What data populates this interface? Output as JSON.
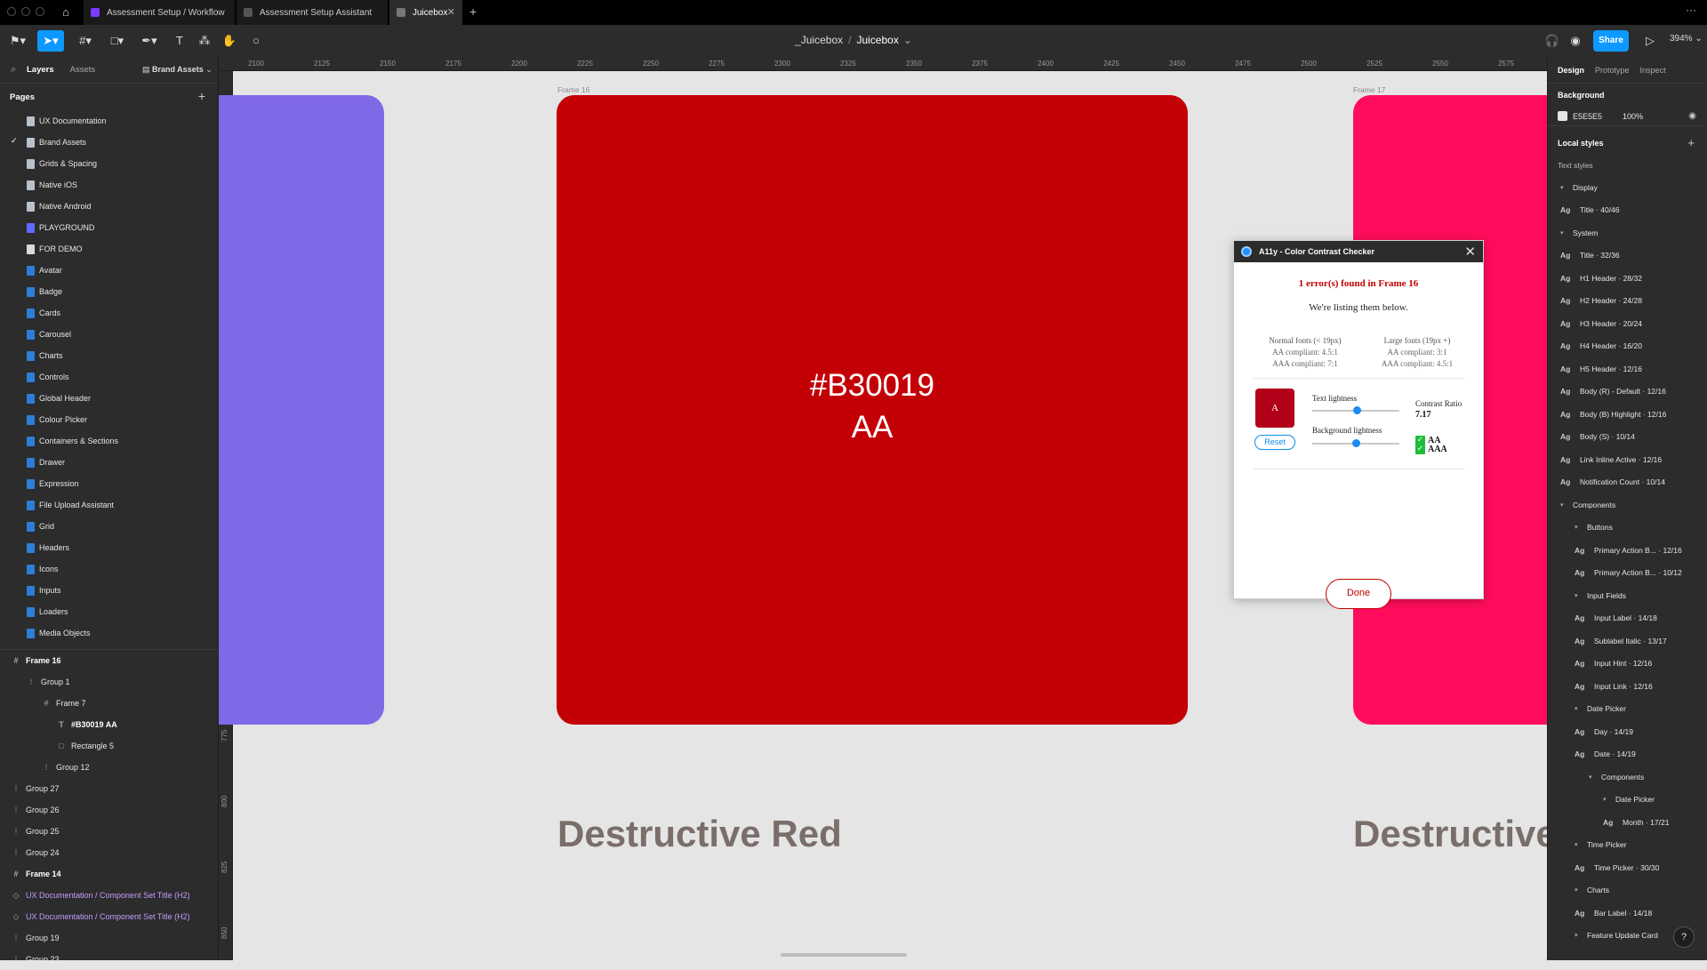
{
  "browser": {
    "tabs": [
      {
        "label": "Assessment Setup / Workflow",
        "color": "#7b3cff"
      },
      {
        "label": "Assessment Setup Assistant",
        "color": "#555555"
      },
      {
        "label": "Juicebox",
        "color": "#555555"
      }
    ],
    "new_tab": "+",
    "more": "···"
  },
  "toolbar": {
    "breadcrumb_team": "_Juicebox",
    "breadcrumb_sep": "/",
    "breadcrumb_file": "Juicebox",
    "share_label": "Share",
    "zoom": "394%"
  },
  "left": {
    "tabs": [
      "Layers",
      "Assets"
    ],
    "page_selector": "Brand Assets",
    "pages_title": "Pages",
    "pages": [
      {
        "label": "UX Documentation",
        "color": "#b8c1cc",
        "selected": false
      },
      {
        "label": "Brand Assets",
        "color": "#b8c1cc",
        "selected": true
      },
      {
        "label": "Grids & Spacing",
        "color": "#b8c1cc",
        "selected": false
      },
      {
        "label": "Native iOS",
        "color": "#b8c1cc",
        "selected": false
      },
      {
        "label": "Native Android",
        "color": "#b8c1cc",
        "selected": false
      },
      {
        "label": "PLAYGROUND",
        "color": "#5b6cff",
        "selected": false
      },
      {
        "label": "FOR DEMO",
        "color": "#d9d9d9",
        "selected": false
      },
      {
        "label": "Avatar",
        "color": "#2b7fd8",
        "selected": false
      },
      {
        "label": "Badge",
        "color": "#2b7fd8",
        "selected": false
      },
      {
        "label": "Cards",
        "color": "#2b7fd8",
        "selected": false
      },
      {
        "label": "Carousel",
        "color": "#2b7fd8",
        "selected": false
      },
      {
        "label": "Charts",
        "color": "#2b7fd8",
        "selected": false
      },
      {
        "label": "Controls",
        "color": "#2b7fd8",
        "selected": false
      },
      {
        "label": "Global Header",
        "color": "#2b7fd8",
        "selected": false
      },
      {
        "label": "Colour Picker",
        "color": "#2b7fd8",
        "selected": false
      },
      {
        "label": "Containers & Sections",
        "color": "#2b7fd8",
        "selected": false
      },
      {
        "label": "Drawer",
        "color": "#2b7fd8",
        "selected": false
      },
      {
        "label": "Expression",
        "color": "#2b7fd8",
        "selected": false
      },
      {
        "label": "File Upload Assistant",
        "color": "#2b7fd8",
        "selected": false
      },
      {
        "label": "Grid",
        "color": "#2b7fd8",
        "selected": false
      },
      {
        "label": "Headers",
        "color": "#2b7fd8",
        "selected": false
      },
      {
        "label": "Icons",
        "color": "#2b7fd8",
        "selected": false
      },
      {
        "label": "Inputs",
        "color": "#2b7fd8",
        "selected": false
      },
      {
        "label": "Loaders",
        "color": "#2b7fd8",
        "selected": false
      },
      {
        "label": "Media Objects",
        "color": "#2b7fd8",
        "selected": false
      }
    ],
    "layers": [
      {
        "label": "Frame 16",
        "icon": "#",
        "depth": 0,
        "style": "bold"
      },
      {
        "label": "Group 1",
        "icon": "⁞",
        "depth": 1,
        "style": ""
      },
      {
        "label": "Frame 7",
        "icon": "#",
        "depth": 2,
        "style": ""
      },
      {
        "label": "#B30019 AA",
        "icon": "T",
        "depth": 3,
        "style": "bold"
      },
      {
        "label": "Rectangle 5",
        "icon": "□",
        "depth": 3,
        "style": ""
      },
      {
        "label": "Group 12",
        "icon": "⁞",
        "depth": 2,
        "style": ""
      },
      {
        "label": "Group 27",
        "icon": "⁞",
        "depth": 0,
        "style": ""
      },
      {
        "label": "Group 26",
        "icon": "⁞",
        "depth": 0,
        "style": ""
      },
      {
        "label": "Group 25",
        "icon": "⁞",
        "depth": 0,
        "style": ""
      },
      {
        "label": "Group 24",
        "icon": "⁞",
        "depth": 0,
        "style": ""
      },
      {
        "label": "Frame 14",
        "icon": "#",
        "depth": 0,
        "style": "bold"
      },
      {
        "label": "UX Documentation / Component Set Title (H2)",
        "icon": "◇",
        "depth": 0,
        "style": "purple"
      },
      {
        "label": "UX Documentation / Component Set Title (H2)",
        "icon": "◇",
        "depth": 0,
        "style": "purple"
      },
      {
        "label": "Group 19",
        "icon": "⁞",
        "depth": 0,
        "style": ""
      },
      {
        "label": "Group 23",
        "icon": "⁞",
        "depth": 0,
        "style": ""
      }
    ]
  },
  "canvas": {
    "ruler_top": [
      "2100",
      "2125",
      "2150",
      "2175",
      "2200",
      "2225",
      "2250",
      "2275",
      "2300",
      "2325",
      "2350",
      "2375",
      "2400",
      "2425",
      "2450",
      "2475",
      "2500",
      "2525",
      "2550",
      "2575"
    ],
    "ruler_left": [
      "550",
      "575",
      "600",
      "625",
      "650",
      "675",
      "700",
      "725",
      "750",
      "775",
      "800",
      "825",
      "850"
    ],
    "frame16_label": "Frame 16",
    "frame17_label": "Frame 17",
    "swatch_left_color": "#8069E6",
    "swatch_main_color": "#C40007",
    "swatch_right_color": "#FF0D5C",
    "swatch_hex": "#B30019",
    "swatch_rating": "AA",
    "title_main": "Destructive Red",
    "title_right": "Destructive"
  },
  "dialog": {
    "title": "A11y - Color Contrast Checker",
    "error": "1 error(s) found in Frame 16",
    "subtitle": "We're listing them below.",
    "normal_head": "Normal fonts (< 19px)",
    "normal_aa": "AA compliant: 4.5:1",
    "normal_aaa": "AAA compliant: 7:1",
    "large_head": "Large fonts (19px +)",
    "large_aa": "AA compliant: 3:1",
    "large_aaa": "AAA compliant: 4.5:1",
    "preview_letter": "A",
    "reset_label": "Reset",
    "text_lightness_label": "Text lightness",
    "text_lightness": 0.52,
    "bg_lightness_label": "Background lightness",
    "bg_lightness": 0.5,
    "contrast_label": "Contrast Ratio",
    "contrast_value": "7.17",
    "pass_aa": "AA",
    "pass_aaa": "AAA",
    "done_label": "Done"
  },
  "right": {
    "tabs": [
      "Design",
      "Prototype",
      "Inspect"
    ],
    "background_title": "Background",
    "background_hex": "E5E5E5",
    "background_opacity": "100%",
    "local_styles_title": "Local styles",
    "text_styles_label": "Text styles",
    "styles": [
      {
        "kind": "group",
        "label": "Display",
        "indent": 0
      },
      {
        "kind": "style",
        "label": "Title · 40/46",
        "indent": 0
      },
      {
        "kind": "group",
        "label": "System",
        "indent": 0
      },
      {
        "kind": "style",
        "label": "Title · 32/36",
        "indent": 0
      },
      {
        "kind": "style",
        "label": "H1 Header · 28/32",
        "indent": 0
      },
      {
        "kind": "style",
        "label": "H2 Header · 24/28",
        "indent": 0
      },
      {
        "kind": "style",
        "label": "H3 Header · 20/24",
        "indent": 0
      },
      {
        "kind": "style",
        "label": "H4 Header · 16/20",
        "indent": 0
      },
      {
        "kind": "style",
        "label": "H5 Header · 12/16",
        "indent": 0
      },
      {
        "kind": "style",
        "label": "Body (R) - Default · 12/16",
        "indent": 0
      },
      {
        "kind": "style",
        "label": "Body (B) Highlight · 12/16",
        "indent": 0
      },
      {
        "kind": "style",
        "label": "Body (S) · 10/14",
        "indent": 0
      },
      {
        "kind": "style",
        "label": "Link Inline Active · 12/16",
        "indent": 0
      },
      {
        "kind": "style",
        "label": "Notification Count · 10/14",
        "indent": 0
      },
      {
        "kind": "group",
        "label": "Components",
        "indent": 0
      },
      {
        "kind": "group",
        "label": "Buttons",
        "indent": 1
      },
      {
        "kind": "style",
        "label": "Primary Action B... · 12/16",
        "indent": 1
      },
      {
        "kind": "style",
        "label": "Primary Action B... · 10/12",
        "indent": 1
      },
      {
        "kind": "group",
        "label": "Input Fields",
        "indent": 1
      },
      {
        "kind": "style",
        "label": "Input Label · 14/18",
        "indent": 1
      },
      {
        "kind": "style",
        "label": "Sublabel Italic · 13/17",
        "indent": 1
      },
      {
        "kind": "style",
        "label": "Input Hint · 12/16",
        "indent": 1
      },
      {
        "kind": "style",
        "label": "Input Link · 12/16",
        "indent": 1
      },
      {
        "kind": "group",
        "label": "Date Picker",
        "indent": 1
      },
      {
        "kind": "style",
        "label": "Day · 14/19",
        "indent": 1
      },
      {
        "kind": "style",
        "label": "Date · 14/19",
        "indent": 1
      },
      {
        "kind": "group",
        "label": "Components",
        "indent": 2
      },
      {
        "kind": "group",
        "label": "Date Picker",
        "indent": 3
      },
      {
        "kind": "style",
        "label": "Month · 17/21",
        "indent": 3
      },
      {
        "kind": "group",
        "label": "Time Picker",
        "indent": 1
      },
      {
        "kind": "style",
        "label": "Time Picker · 30/30",
        "indent": 1
      },
      {
        "kind": "group",
        "label": "Charts",
        "indent": 1
      },
      {
        "kind": "style",
        "label": "Bar Label · 14/18",
        "indent": 1
      },
      {
        "kind": "group",
        "label": "Feature Update Card",
        "indent": 1
      }
    ],
    "help": "?"
  }
}
